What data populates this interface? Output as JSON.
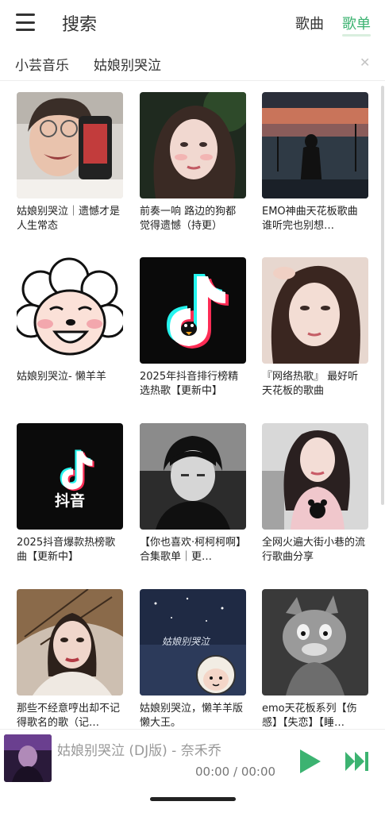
{
  "header": {
    "menu_icon": "menu-icon",
    "title": "搜索",
    "tabs": [
      {
        "label": "歌曲",
        "active": false
      },
      {
        "label": "歌单",
        "active": true
      }
    ],
    "accent_color": "#3cb371"
  },
  "search": {
    "source": "小芸音乐",
    "query": "姑娘别哭泣",
    "clear_icon": "close-icon"
  },
  "playlists": [
    {
      "title": "姑娘别哭泣｜遗憾才是人生常态",
      "cover": "crying-woman-photo"
    },
    {
      "title": "前奏一响 路边的狗都觉得遗憾（持更）",
      "cover": "girl-portrait-dark"
    },
    {
      "title": "EMO神曲天花板歌曲 谁听完也别想…",
      "cover": "sunset-sea-silhouette"
    },
    {
      "title": "姑娘别哭泣- 懒羊羊",
      "cover": "cartoon-sheep"
    },
    {
      "title": "2025年抖音排行榜精选热歌【更新中】",
      "cover": "tiktok-logo-penguin"
    },
    {
      "title": "『网络热歌』 最好听天花板的歌曲",
      "cover": "girl-portrait-light"
    },
    {
      "title": "2025抖音爆款热榜歌曲【更新中】",
      "cover": "tiktok-logo-text"
    },
    {
      "title": "【你也喜欢·柯柯柯啊】合集歌单｜更…",
      "cover": "anime-boy-sketch"
    },
    {
      "title": "全网火遍大街小巷的流行歌曲分享",
      "cover": "girl-bear-shirt"
    },
    {
      "title": "那些不经意哼出却不记得歌名的歌（记…",
      "cover": "woman-umbrella"
    },
    {
      "title": "姑娘别哭泣，懒羊羊版懒大王。",
      "cover": "night-sky-sheep"
    },
    {
      "title": "emo天花板系列【伤感】【失恋】【睡…",
      "cover": "cartoon-cat-sketch"
    }
  ],
  "tiktok_cover_text": "抖音",
  "night_cover_text": "姑娘别哭泣",
  "player": {
    "title": "姑娘别哭泣 (DJ版) - 奈禾乔",
    "time": "00:00 / 00:00",
    "play_icon": "play-icon",
    "next_icon": "next-track-icon"
  }
}
